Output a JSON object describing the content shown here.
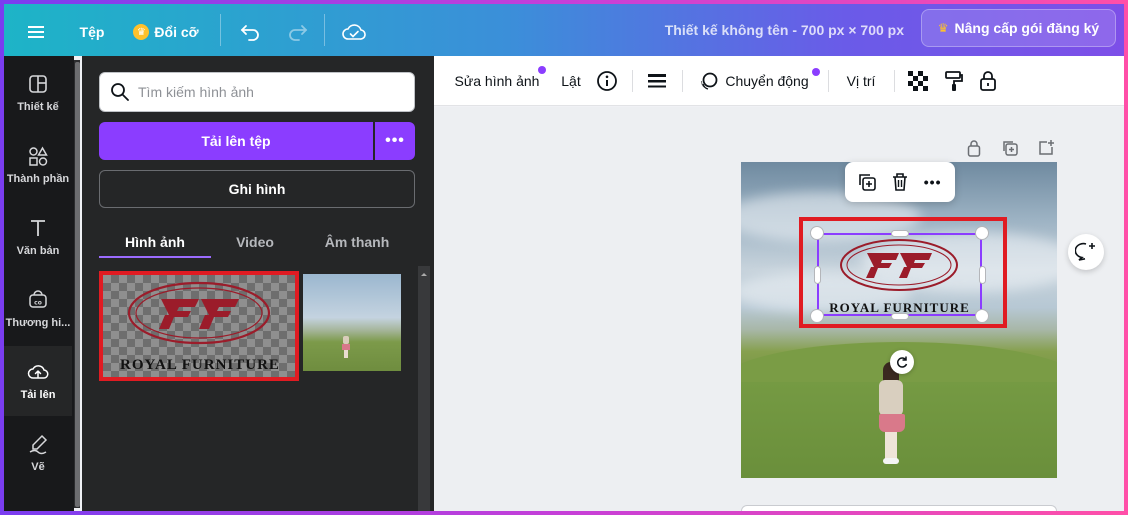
{
  "topbar": {
    "file_label": "Tệp",
    "resize_label": "Đổi cỡ",
    "doc_title": "Thiết kế không tên - 700 px × 700 px",
    "upgrade_label": "Nâng cấp gói đăng ký"
  },
  "rail": {
    "items": [
      {
        "label": "Thiết kế",
        "icon": "layout-icon"
      },
      {
        "label": "Thành phần",
        "icon": "shapes-icon"
      },
      {
        "label": "Văn bản",
        "icon": "text-icon"
      },
      {
        "label": "Thương hi...",
        "icon": "brand-icon"
      },
      {
        "label": "Tải lên",
        "icon": "cloud-upload-icon"
      },
      {
        "label": "Vẽ",
        "icon": "draw-icon"
      }
    ],
    "active_index": 4
  },
  "panel": {
    "search_placeholder": "Tìm kiếm hình ảnh",
    "upload_label": "Tải lên tệp",
    "record_label": "Ghi hình",
    "tabs": [
      {
        "label": "Hình ảnh"
      },
      {
        "label": "Video"
      },
      {
        "label": "Âm thanh"
      }
    ],
    "active_tab": 0,
    "thumb_logo_text": "ROYAL FURNITURE"
  },
  "context_toolbar": {
    "edit_image": "Sửa hình ảnh",
    "flip": "Lật",
    "animate": "Chuyển động",
    "position": "Vị trí"
  },
  "canvas": {
    "logo_text": "ROYAL FURNITURE"
  },
  "colors": {
    "accent": "#8b3dff",
    "highlight_red": "#e01b22",
    "logo_red": "#9b1c2a"
  }
}
